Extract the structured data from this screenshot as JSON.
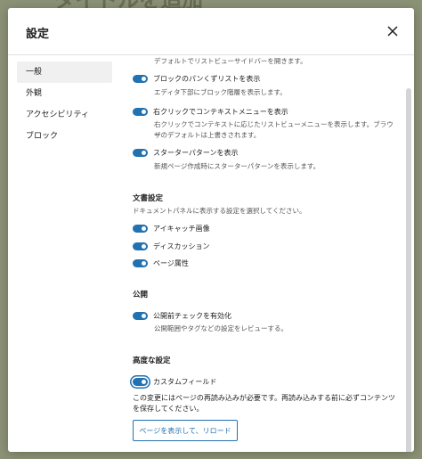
{
  "background": {
    "title": "タイトルを追加"
  },
  "modal": {
    "title": "設定",
    "close_icon": "close-icon"
  },
  "sidebar": {
    "items": [
      {
        "label": "一般",
        "active": true
      },
      {
        "label": "外観"
      },
      {
        "label": "アクセシビリティ"
      },
      {
        "label": "ブロック"
      }
    ]
  },
  "general": {
    "top_desc": "デフォルトでリストビューサイドバーを開きます。",
    "options": [
      {
        "label": "ブロックのパンくずリストを表示",
        "desc": "エディタ下部にブロック階層を表示します。",
        "checked": true
      },
      {
        "label": "右クリックでコンテキストメニューを表示",
        "desc_line1": "右クリックでコンテキストに応じたリストビューメニューを表示します。ブラウザ",
        "desc_line2": "ーのデフォルトは上書きされます。",
        "checked": true
      },
      {
        "label": "スターターパターンを表示",
        "desc": "新規ページ作成時にスターターパターンを表示します。",
        "checked": true
      }
    ]
  },
  "document": {
    "title": "文書設定",
    "desc": "ドキュメントパネルに表示する設定を選択してください。",
    "options": [
      {
        "label": "アイキャッチ画像",
        "checked": true
      },
      {
        "label": "ディスカッション",
        "checked": true
      },
      {
        "label": "ページ属性",
        "checked": true
      }
    ]
  },
  "publish": {
    "title": "公開",
    "option": {
      "label": "公開前チェックを有効化",
      "desc": "公開範囲やタグなどの設定をレビューする。",
      "checked": true
    }
  },
  "advanced": {
    "title": "高度な設定",
    "option": {
      "label": "カスタムフィールド",
      "checked": true
    },
    "notice_line1": "この変更にはページの再読み込みが必要です。再読み込みする前に必ずコンテンツ",
    "notice_line2": "を保存してください。",
    "reload_button": "ページを表示して、リロード"
  },
  "colors": {
    "accent": "#2271b1",
    "backdrop": "#8c9276"
  }
}
